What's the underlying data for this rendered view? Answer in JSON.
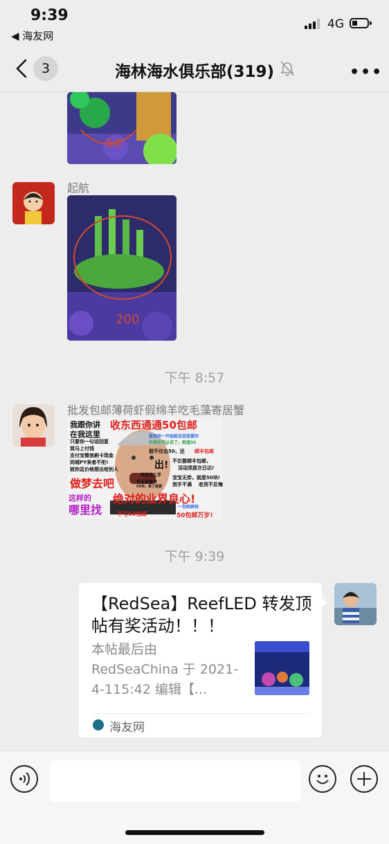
{
  "status": {
    "time": "9:39",
    "back_app": "◀ 海友网",
    "network": "4G",
    "battery_fraction": 0.35
  },
  "nav": {
    "back_badge": "3",
    "title": "海林海水俱乐部(319)",
    "more": "•••"
  },
  "messages": {
    "m2": {
      "sender": "起航"
    },
    "ts1": "下午 8:57",
    "m3": {
      "sender": "批发包邮薄荷虾假绵羊吃毛藻寄居蟹",
      "meme": [
        "我跟你讲",
        "在我这里",
        "只要你一句话回复",
        "我马上付钱",
        "支付宝微信刷卡现金",
        "同城PY来者不拒!",
        "就你这价格想出给别人",
        "收东西通通50包邮",
        "要我你一开始就说说我要的",
        "价钱也可以说了，就值50",
        "我不仅出50，还",
        "顺丰包邮",
        "出!",
        "不仅要顺丰包邮，",
        "活动须是次日达!",
        "做梦去吧",
        "就我这二手",
        "专业接盘侠",
        "50块，来了就要",
        "宝宝无奈，就是50块!",
        "到手不满",
        "收货不反悔",
        "这样的",
        "绝对的业界良心!",
        "哪里找",
        "一包邮爽快",
        "不亏50包邮",
        "50包邮万岁!"
      ]
    },
    "ts2": "下午 9:39",
    "card": {
      "title": "【RedSea】ReefLED 转发顶帖有奖活动！！！",
      "desc": "本帖最后由 RedSeaChina 于 2021-4-115:42 编辑【...",
      "source": "海友网"
    }
  },
  "input": {
    "placeholder": ""
  },
  "colors": {
    "background": "#ededed",
    "card": "#ffffff",
    "timestamp": "#a0a0a0",
    "meme_red": "#e0201c",
    "meme_purple": "#b31fc4"
  }
}
